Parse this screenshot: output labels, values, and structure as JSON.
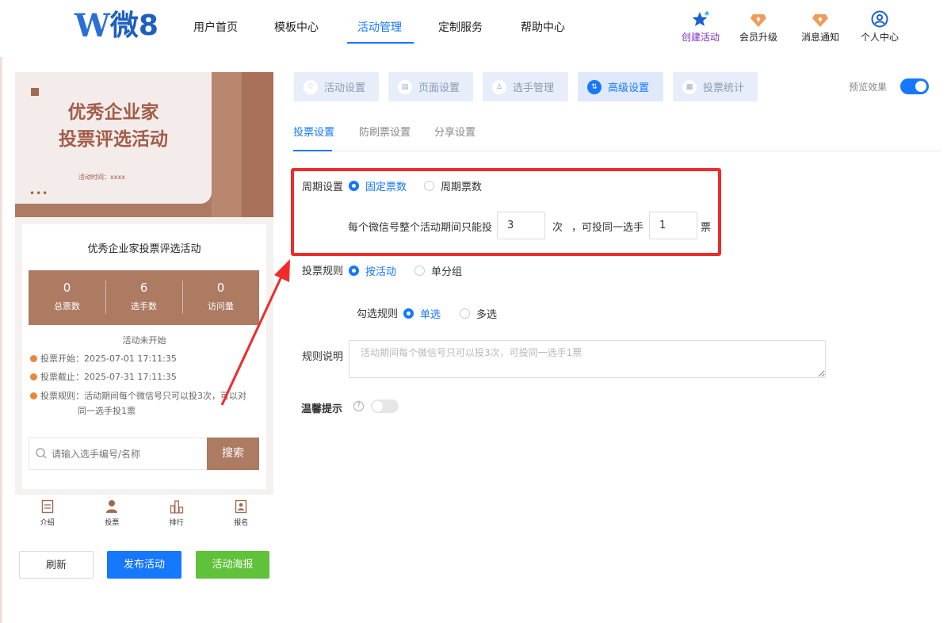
{
  "brand": {
    "mark": "W",
    "text": "微8"
  },
  "nav": {
    "items": [
      {
        "label": "用户首页"
      },
      {
        "label": "模板中心"
      },
      {
        "label": "活动管理",
        "active": true
      },
      {
        "label": "定制服务"
      },
      {
        "label": "帮助中心"
      }
    ]
  },
  "toolbar": {
    "create": "创建活动",
    "upgrade": "会员升级",
    "notify": "消息通知",
    "profile": "个人中心"
  },
  "preview": {
    "banner_title_line1": "优秀企业家",
    "banner_title_line2": "投票评选活动",
    "banner_time": "活动时间：xxxx",
    "banner_dots": "•••",
    "activity_title": "优秀企业家投票评选活动",
    "stats": [
      {
        "value": "0",
        "label": "总票数"
      },
      {
        "value": "6",
        "label": "选手数"
      },
      {
        "value": "0",
        "label": "访问量"
      }
    ],
    "status": "活动未开始",
    "vote_start": "投票开始：2025-07-01 17:11:35",
    "vote_end": "投票截止：2025-07-31 17:11:35",
    "vote_rule_line1": "投票规则：活动期间每个微信号只可以投3次，可以对",
    "vote_rule_line2": "同一选手投1票",
    "search_placeholder": "请输入选手编号/名称",
    "search_button": "搜索",
    "tabbar": [
      "介绍",
      "投票",
      "排行",
      "报名"
    ]
  },
  "actions": {
    "refresh": "刷新",
    "publish": "发布活动",
    "poster": "活动海报"
  },
  "steps": [
    {
      "label": "活动设置",
      "icon": "heart-icon"
    },
    {
      "label": "页面设置",
      "icon": "page-icon"
    },
    {
      "label": "选手管理",
      "icon": "user-icon"
    },
    {
      "label": "高级设置",
      "icon": "advanced-icon",
      "active": true
    },
    {
      "label": "投票统计",
      "icon": "stats-icon"
    }
  ],
  "preview_toggle": {
    "label": "预览效果",
    "on": true
  },
  "subtabs": [
    {
      "label": "投票设置",
      "active": true
    },
    {
      "label": "防刷票设置"
    },
    {
      "label": "分享设置"
    }
  ],
  "form": {
    "cycle": {
      "label": "周期设置",
      "options": [
        {
          "label": "固定票数",
          "checked": true
        },
        {
          "label": "周期票数"
        }
      ],
      "text_before": "每个微信号整个活动期间只能投",
      "count_value": "3",
      "unit_times": "次",
      "text_middle": "，可投同一选手",
      "same_value": "1",
      "unit_votes": "票"
    },
    "rule": {
      "label": "投票规则",
      "options": [
        {
          "label": "按活动",
          "checked": true
        },
        {
          "label": "单分组"
        }
      ]
    },
    "select_rule": {
      "label": "勾选规则",
      "options": [
        {
          "label": "单选",
          "checked": true
        },
        {
          "label": "多选"
        }
      ]
    },
    "description": {
      "label": "规则说明",
      "placeholder": "活动期间每个微信号只可以投3次，可投同一选手1票"
    },
    "tip": {
      "label": "温馨提示",
      "help": "?",
      "on": false
    }
  },
  "colors": {
    "accent": "#1677ff",
    "brand_brown": "#ad7a62",
    "highlight_red": "#ef2b2b",
    "green": "#5fc23a"
  }
}
